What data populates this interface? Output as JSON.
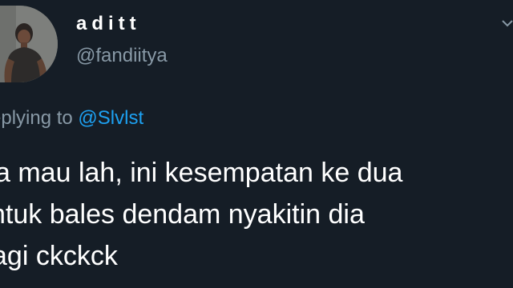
{
  "author": {
    "display_name": "aditt",
    "handle": "@fandiitya",
    "avatar_icon": "user-photo-avatar"
  },
  "reply": {
    "prefix": "eplying to",
    "mention": "@Slvlst"
  },
  "tweet": {
    "lines": [
      "a mau lah, ini kesempatan ke dua",
      "ntuk bales dendam nyakitin dia",
      "agi ckckck"
    ]
  },
  "colors": {
    "background": "#151d26",
    "text_primary": "#ffffff",
    "text_secondary": "#8899a6",
    "link": "#1da1f2"
  },
  "icons": {
    "menu": "chevron-down-icon"
  }
}
